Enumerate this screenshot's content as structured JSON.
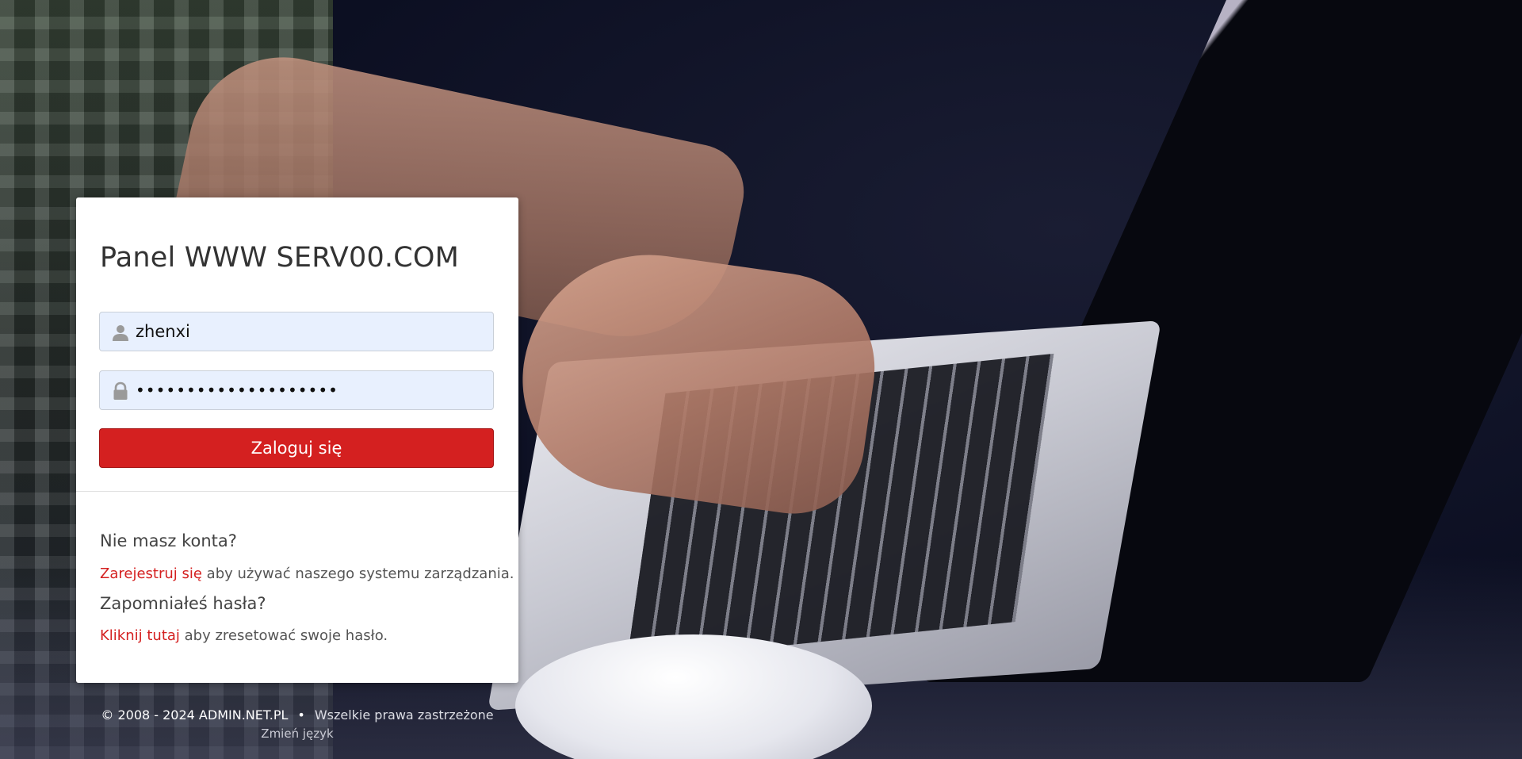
{
  "login": {
    "title": "Panel WWW SERV00.COM",
    "username_value": "zhenxi",
    "password_value": "••••••••••••••••••••",
    "submit_label": "Zaloguj się",
    "user_icon": "user-icon",
    "lock_icon": "lock-icon"
  },
  "help": {
    "no_account_heading": "Nie masz konta?",
    "register_link": "Zarejestruj się",
    "register_suffix": " aby używać naszego systemu zarządzania.",
    "forgot_heading": "Zapomniałeś hasła?",
    "reset_link": "Kliknij tutaj",
    "reset_suffix": " aby zresetować swoje hasło."
  },
  "footer": {
    "copyright": "© 2008 - 2024 ADMIN.NET.PL",
    "bullet": "•",
    "rights": "Wszelkie prawa zastrzeżone",
    "change_language": "Zmień język"
  },
  "colors": {
    "accent": "#d42020",
    "input_bg": "#e8f0fe"
  }
}
